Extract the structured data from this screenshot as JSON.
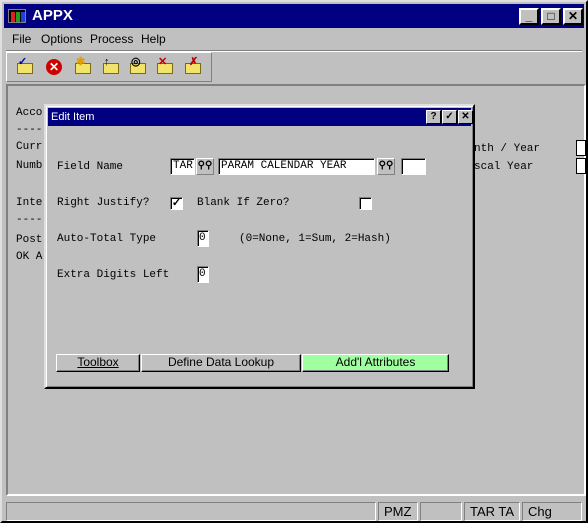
{
  "window": {
    "title": "APPX",
    "controls": {
      "minimize": "_",
      "maximize": "□",
      "close": "✕"
    }
  },
  "menu": [
    "File",
    "Options",
    "Process",
    "Help"
  ],
  "toolbar": {
    "icons": [
      "check-folder-icon",
      "stop-icon",
      "new-folder-icon",
      "open-folder-icon",
      "find-folder-icon",
      "delete-folder-icon",
      "close-folder-icon"
    ]
  },
  "background": {
    "lines": [
      "Acco",
      "----",
      "Curr",
      "Numb",
      "Inte",
      "----",
      "Post",
      "OK A"
    ],
    "right_labels": [
      "nth / Year",
      "scal Year"
    ]
  },
  "dialog": {
    "title": "Edit Item",
    "buttons": {
      "help": "?",
      "ok": "✓",
      "close": "✕"
    },
    "field_name_label": "Field Name",
    "field_app": "TAR",
    "field_name": "PARAM CALENDAR YEAR",
    "field_extra": "",
    "right_justify_label": "Right Justify?",
    "right_justify_checked": true,
    "right_justify_mark": "✓",
    "blank_if_zero_label": "Blank If Zero?",
    "blank_if_zero_checked": false,
    "blank_if_zero_mark": "",
    "auto_total_label": "Auto-Total Type",
    "auto_total_value": "0",
    "auto_total_hint": "(0=None, 1=Sum, 2=Hash)",
    "extra_digits_label": "Extra Digits Left",
    "extra_digits_value": "0",
    "buttons_bottom": [
      "Toolbox",
      "Define Data Lookup",
      "Add'l Attributes"
    ],
    "highlight_color": "#a0ffa0"
  },
  "status": {
    "cells": [
      "PMZ",
      "",
      "TAR TA",
      "Chg"
    ]
  }
}
